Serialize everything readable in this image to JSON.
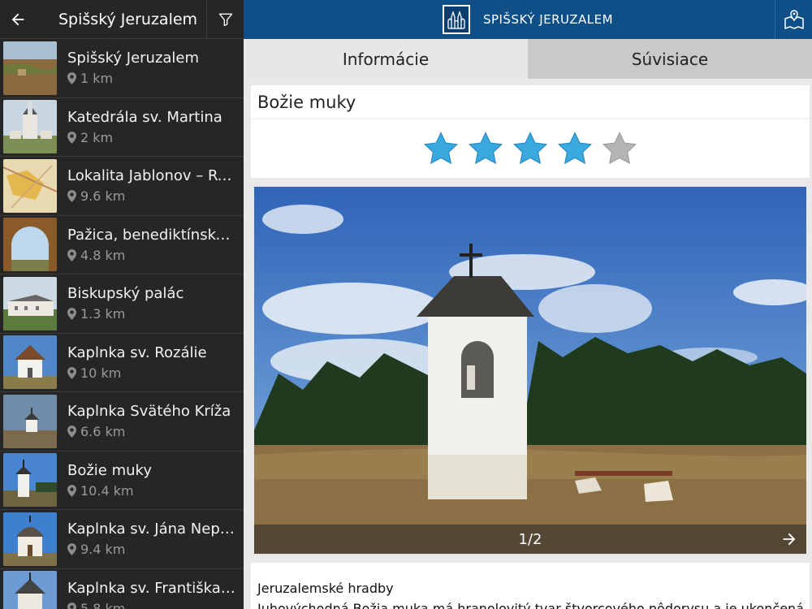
{
  "sidebar": {
    "title": "Spišský Jeruzalem",
    "items": [
      {
        "name": "Spišský Jeruzalem",
        "distance": "1 km"
      },
      {
        "name": "Katedrála sv. Martina",
        "distance": "2 km"
      },
      {
        "name": "Lokalita Jablonov – Ry...",
        "distance": "9.6 km"
      },
      {
        "name": "Pažica, benediktínsky ...",
        "distance": "4.8 km"
      },
      {
        "name": "Biskupský palác",
        "distance": "1.3 km"
      },
      {
        "name": "Kaplnka sv. Rozálie",
        "distance": "10 km"
      },
      {
        "name": "Kaplnka Svätého Kríža",
        "distance": "6.6 km"
      },
      {
        "name": "Božie muky",
        "distance": "10.4 km"
      },
      {
        "name": "Kaplnka sv. Jána Nepo...",
        "distance": "9.4 km"
      },
      {
        "name": "Kaplnka sv. Františka ...",
        "distance": "5.8 km"
      }
    ]
  },
  "header": {
    "app_title": "SPIŠSKÝ JERUZALEM"
  },
  "tabs": [
    {
      "label": "Informácie"
    },
    {
      "label": "Súvisiace"
    }
  ],
  "detail": {
    "title": "Božie muky",
    "rating": 4,
    "rating_max": 5,
    "photo_counter": "1/2",
    "section_heading": "Jeruzalemské hradby",
    "description": "Juhovýchodná Božia muka má hranolovitý tvar štvorcového pôdorysu a je ukončená"
  },
  "colors": {
    "header_bg": "#0e4f88",
    "sidebar_bg": "#262626",
    "star_filled": "#3aa9e0",
    "star_empty": "#b5b5b5"
  },
  "icons": {
    "back": "arrow-left-icon",
    "filter": "filter-icon",
    "map": "map-icon",
    "pin": "location-pin-icon",
    "next": "arrow-right-icon"
  }
}
